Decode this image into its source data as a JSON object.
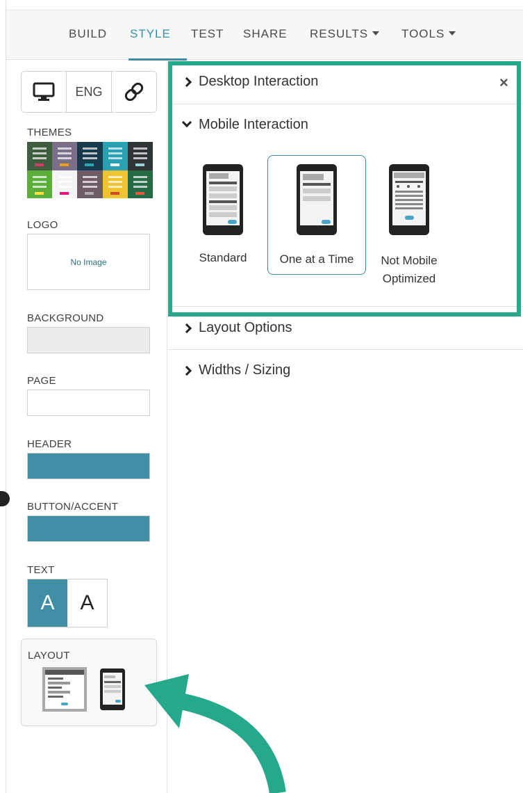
{
  "nav": {
    "items": [
      {
        "label": "BUILD",
        "active": false,
        "dropdown": false
      },
      {
        "label": "STYLE",
        "active": true,
        "dropdown": false
      },
      {
        "label": "TEST",
        "active": false,
        "dropdown": false
      },
      {
        "label": "SHARE",
        "active": false,
        "dropdown": false
      },
      {
        "label": "RESULTS",
        "active": false,
        "dropdown": true
      },
      {
        "label": "TOOLS",
        "active": false,
        "dropdown": true
      }
    ]
  },
  "sidebar": {
    "view_toggle": {
      "desktop_icon": "desktop-icon",
      "language": "ENG",
      "link_icon": "link-icon"
    },
    "themes_label": "THEMES",
    "themes": [
      {
        "bg": "#3f5e3f",
        "accent": "#d23a67"
      },
      {
        "bg": "#7a6e88",
        "accent": "#e4a11b"
      },
      {
        "bg": "#173b4d",
        "accent": "#2aa6b5"
      },
      {
        "bg": "#2aa0b3",
        "accent": "#f2f2f2"
      },
      {
        "bg": "#2f3436",
        "accent": "#9bd1d9"
      },
      {
        "bg": "#5cae3a",
        "accent": "#ffe040"
      },
      {
        "bg": "#f4f4f4",
        "accent": "#e0197a"
      },
      {
        "bg": "#6d5b66",
        "accent": "#b0a6ad"
      },
      {
        "bg": "#f0c330",
        "accent": "#cf4b26"
      },
      {
        "bg": "#256b45",
        "accent": "#e05b3b"
      }
    ],
    "logo_label": "LOGO",
    "logo_placeholder": "No Image",
    "background_label": "BACKGROUND",
    "background_color": "#ececec",
    "page_label": "PAGE",
    "page_color": "#ffffff",
    "header_label": "HEADER",
    "header_color": "#3f8ea3",
    "button_label": "BUTTON/ACCENT",
    "button_color": "#3f8ea3",
    "text_label": "TEXT",
    "text_dark": "A",
    "text_light": "A",
    "layout_label": "LAYOUT"
  },
  "main": {
    "desktop_interaction": "Desktop Interaction",
    "mobile_interaction": "Mobile Interaction",
    "options": [
      {
        "label": "Standard",
        "selected": false
      },
      {
        "label": "One at a Time",
        "selected": true
      },
      {
        "label": "Not Mobile Optimized",
        "selected": false
      }
    ],
    "layout_options": "Layout Options",
    "widths_sizing": "Widths / Sizing",
    "close_symbol": "×"
  },
  "colors": {
    "accent": "#3a8ea0",
    "highlight": "#26a98b"
  }
}
